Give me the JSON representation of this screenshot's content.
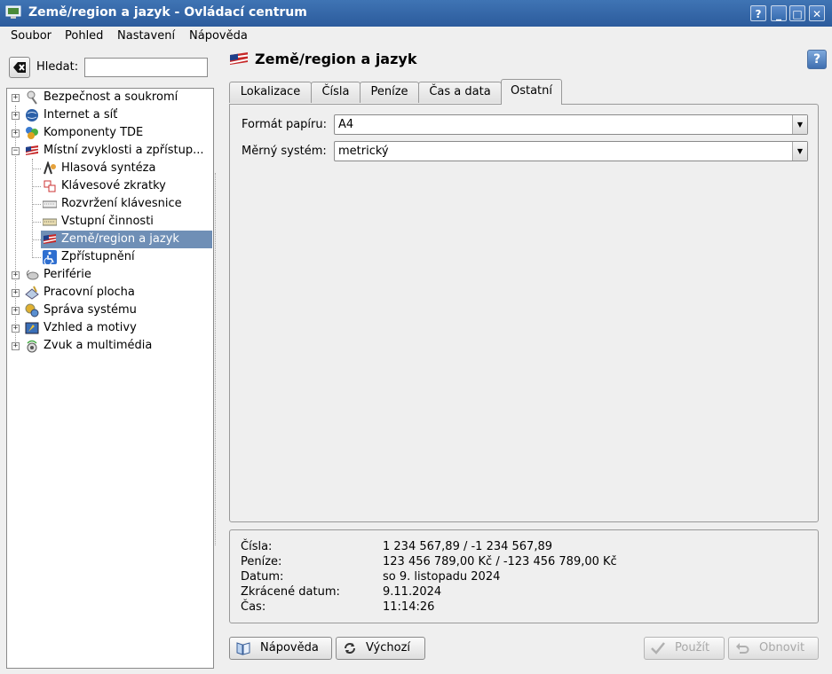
{
  "window": {
    "title": "Země/region a jazyk - Ovládací centrum",
    "buttons": {
      "help": "?",
      "minimize": "_",
      "maximize": "□",
      "close": "✕"
    }
  },
  "menubar": {
    "items": [
      "Soubor",
      "Pohled",
      "Nastavení",
      "Nápověda"
    ]
  },
  "search": {
    "label": "Hledat:",
    "value": ""
  },
  "tree": {
    "items": [
      {
        "label": "Bezpečnost a soukromí",
        "icon": "security-icon"
      },
      {
        "label": "Internet a síť",
        "icon": "globe-icon"
      },
      {
        "label": "Komponenty TDE",
        "icon": "components-icon"
      },
      {
        "label": "Místní zvyklosti a zpřístup...",
        "icon": "locale-flag-icon"
      },
      {
        "label": "Hlasová syntéza",
        "icon": "speech-icon"
      },
      {
        "label": "Klávesové zkratky",
        "icon": "shortcuts-icon"
      },
      {
        "label": "Rozvržení klávesnice",
        "icon": "keyboard-layout-icon"
      },
      {
        "label": "Vstupní činnosti",
        "icon": "keyboard-icon"
      },
      {
        "label": "Země/region a jazyk",
        "icon": "flag-icon"
      },
      {
        "label": "Zpřístupnění",
        "icon": "accessibility-icon"
      },
      {
        "label": "Periférie",
        "icon": "peripherals-icon"
      },
      {
        "label": "Pracovní plocha",
        "icon": "desktop-icon"
      },
      {
        "label": "Správa systému",
        "icon": "system-admin-icon"
      },
      {
        "label": "Vzhled a motivy",
        "icon": "appearance-icon"
      },
      {
        "label": "Zvuk a multimédia",
        "icon": "sound-icon"
      }
    ]
  },
  "page": {
    "title": "Země/region a jazyk"
  },
  "tabs": [
    "Lokalizace",
    "Čísla",
    "Peníze",
    "Čas a data",
    "Ostatní"
  ],
  "form": {
    "paper": {
      "label": "Formát papíru:",
      "value": "A4"
    },
    "measure": {
      "label": "Měrný systém:",
      "value": "metrický"
    }
  },
  "preview": {
    "rows": [
      {
        "label": "Čísla:",
        "value": "1 234 567,89 / -1 234 567,89"
      },
      {
        "label": "Peníze:",
        "value": "123 456 789,00 Kč / -123 456 789,00 Kč"
      },
      {
        "label": "Datum:",
        "value": "so 9. listopadu 2024"
      },
      {
        "label": "Zkrácené datum:",
        "value": "9.11.2024"
      },
      {
        "label": "Čas:",
        "value": "11:14:26"
      }
    ]
  },
  "buttons": {
    "help": "Nápověda",
    "defaults": "Výchozí",
    "apply": "Použít",
    "reset": "Obnovit"
  },
  "colors": {
    "titlebar": "#2f5f9f",
    "selection": "#6f8fb6"
  }
}
